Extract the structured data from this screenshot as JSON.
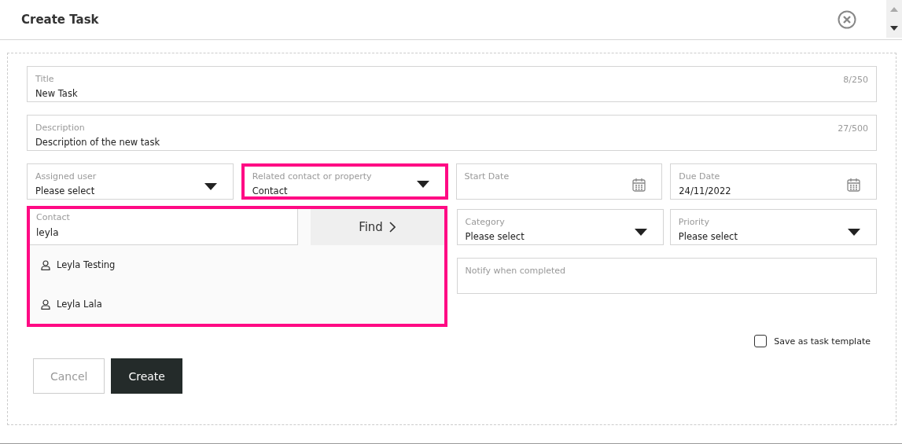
{
  "dialog": {
    "title": "Create Task"
  },
  "title_field": {
    "label": "Title",
    "value": "New Task",
    "counter": "8/250"
  },
  "description_field": {
    "label": "Description",
    "value": "Description of the new task",
    "counter": "27/500"
  },
  "assigned_user": {
    "label": "Assigned user",
    "value": "Please select"
  },
  "related": {
    "label": "Related contact or property",
    "value": "Contact",
    "highlighted": true
  },
  "start_date": {
    "label": "Start Date"
  },
  "due_date": {
    "label": "Due Date",
    "value": "24/11/2022"
  },
  "contact_search": {
    "label": "Contact",
    "value": "leyla",
    "button": "Find",
    "highlighted": true,
    "results": [
      {
        "name": "Leyla Testing"
      },
      {
        "name": "Leyla Lala"
      }
    ]
  },
  "category": {
    "label": "Category",
    "value": "Please select"
  },
  "priority": {
    "label": "Priority",
    "value": "Please select"
  },
  "notify": {
    "label": "Notify when completed"
  },
  "save_template": {
    "label": "Save as task template",
    "checked": false
  },
  "buttons": [
    {
      "label": "Cancel",
      "kind": "secondary"
    },
    {
      "label": "Create",
      "kind": "primary"
    }
  ]
}
